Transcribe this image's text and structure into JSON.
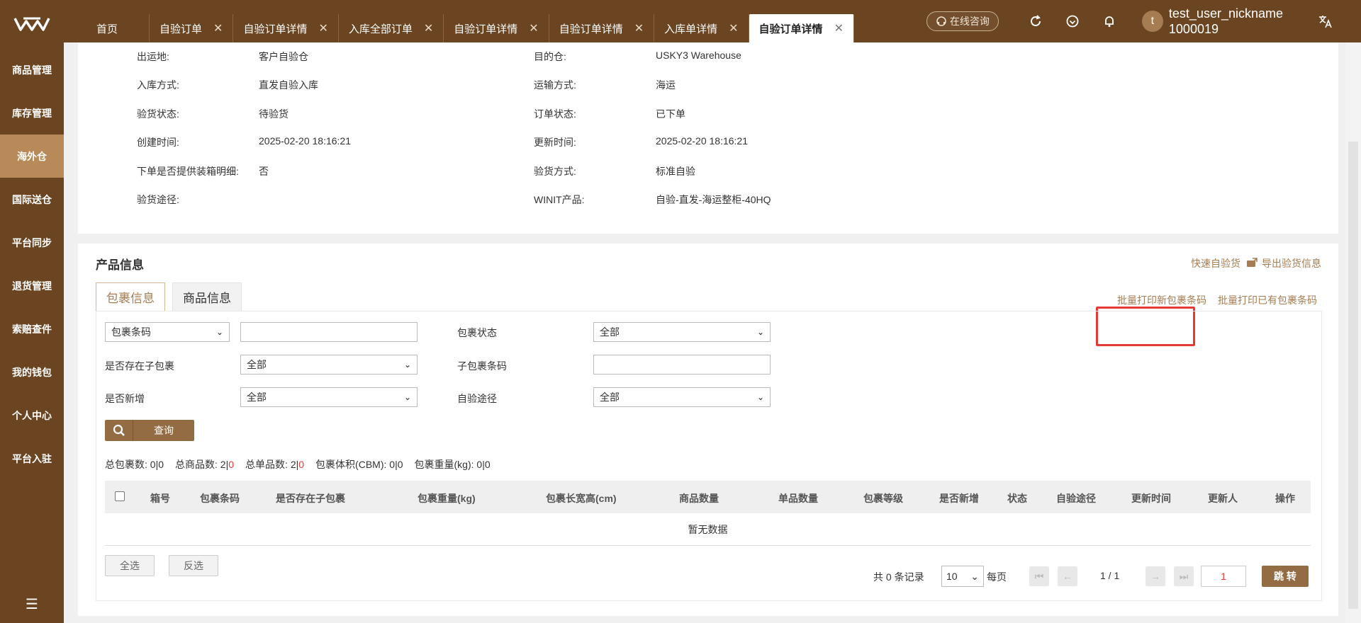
{
  "colors": {
    "brand": "#6b4521",
    "accent": "#a67c52",
    "active_side": "#b88a59",
    "highlight": "#e53935"
  },
  "tabs": [
    {
      "label": "首页",
      "closable": false
    },
    {
      "label": "自验订单",
      "closable": true
    },
    {
      "label": "自验订单详情",
      "closable": true
    },
    {
      "label": "入库全部订单",
      "closable": true
    },
    {
      "label": "自验订单详情",
      "closable": true
    },
    {
      "label": "自验订单详情",
      "closable": true
    },
    {
      "label": "入库单详情",
      "closable": true
    },
    {
      "label": "自验订单详情",
      "closable": true,
      "active": true
    }
  ],
  "header": {
    "consult_label": "在线咨询",
    "user_initial": "t",
    "user_name": "test_user_nickname",
    "user_id": "1000019"
  },
  "sidebar": {
    "items": [
      {
        "label": "商品管理"
      },
      {
        "label": "库存管理"
      },
      {
        "label": "海外仓",
        "active": true
      },
      {
        "label": "国际送仓"
      },
      {
        "label": "平台同步"
      },
      {
        "label": "退货管理"
      },
      {
        "label": "索赔查件"
      },
      {
        "label": "我的钱包"
      },
      {
        "label": "个人中心"
      },
      {
        "label": "平台入驻"
      }
    ]
  },
  "order_info": {
    "rows": [
      {
        "l1": "出运地:",
        "v1": "客户自验仓",
        "l2": "目的仓:",
        "v2": "USKY3 Warehouse"
      },
      {
        "l1": "入库方式:",
        "v1": "直发自验入库",
        "l2": "运输方式:",
        "v2": "海运"
      },
      {
        "l1": "验货状态:",
        "v1": "待验货",
        "l2": "订单状态:",
        "v2": "已下单"
      },
      {
        "l1": "创建时间:",
        "v1": "2025-02-20 18:16:21",
        "l2": "更新时间:",
        "v2": "2025-02-20 18:16:21"
      },
      {
        "l1": "下单是否提供装箱明细:",
        "v1": "否",
        "l2": "验货方式:",
        "v2": "标准自验"
      },
      {
        "l1": "验货途径:",
        "v1": "",
        "l2": "WINIT产品:",
        "v2": "自验-直发-海运整柜-40HQ"
      }
    ]
  },
  "product_section": {
    "title": "产品信息",
    "quick_inspect": "快速自验货",
    "export_info": "导出验货信息",
    "subtabs": [
      "包裹信息",
      "商品信息"
    ],
    "batch_print_new": "批量打印新包裹条码",
    "batch_print_existing": "批量打印已有包裹条码"
  },
  "filters": {
    "barcode_type": "包裹条码",
    "barcode_value": "",
    "package_status_label": "包裹状态",
    "package_status_value": "全部",
    "has_child_label": "是否存在子包裹",
    "has_child_value": "全部",
    "child_barcode_label": "子包裹条码",
    "child_barcode_value": "",
    "is_new_label": "是否新增",
    "is_new_value": "全部",
    "inspect_path_label": "自验途径",
    "inspect_path_value": "全部",
    "query_label": "查询"
  },
  "stats": [
    {
      "label": "总包裹数:",
      "a": "0",
      "b": "0"
    },
    {
      "label": "总商品数:",
      "a": "2",
      "b": "0"
    },
    {
      "label": "总单品数:",
      "a": "2",
      "b": "0"
    },
    {
      "label": "包裹体积(CBM):",
      "a": "0",
      "b": "0"
    },
    {
      "label": "包裹重量(kg):",
      "a": "0",
      "b": "0"
    }
  ],
  "table": {
    "columns": [
      "箱号",
      "包裹条码",
      "是否存在子包裹",
      "包裹重量(kg)",
      "包裹长宽高(cm)",
      "商品数量",
      "单品数量",
      "包裹等级",
      "是否新增",
      "状态",
      "自验途径",
      "更新时间",
      "更新人",
      "操作"
    ],
    "empty_text": "暂无数据"
  },
  "footer": {
    "select_all": "全选",
    "invert": "反选",
    "total_text": "共 0 条记录",
    "page_size": "10",
    "per_page": "每页",
    "page_info": "1 / 1",
    "page_input": "1",
    "jump_label": "跳 转"
  }
}
